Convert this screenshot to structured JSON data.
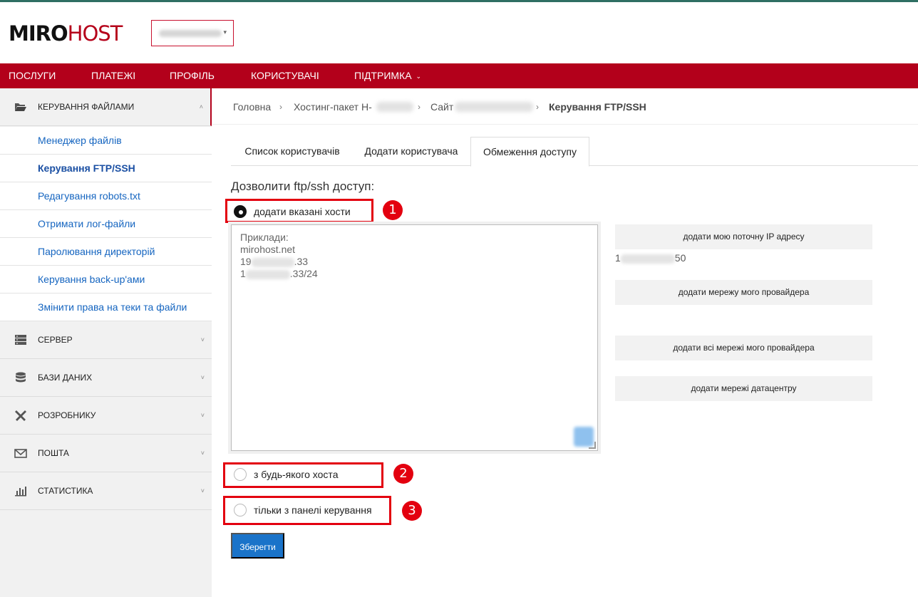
{
  "header": {
    "logo_part1": "MIRO",
    "logo_part2": "HOST",
    "domain_selector": {
      "value": ""
    }
  },
  "nav": [
    {
      "label": "ПОСЛУГИ"
    },
    {
      "label": "ПЛАТЕЖІ"
    },
    {
      "label": "ПРОФІЛЬ"
    },
    {
      "label": "КОРИСТУВАЧІ"
    },
    {
      "label": "ПІДТРИМКА"
    }
  ],
  "sidebar": {
    "file_management": {
      "label": "КЕРУВАННЯ ФАЙЛАМИ",
      "items": [
        {
          "label": "Менеджер файлів"
        },
        {
          "label": "Керування FTP/SSH"
        },
        {
          "label": "Редагування robots.txt"
        },
        {
          "label": "Отримати лог-файли"
        },
        {
          "label": "Паролювання директорій"
        },
        {
          "label": "Керування back-up'ами"
        },
        {
          "label": "Змінити права на теки та файли"
        }
      ]
    },
    "sections": [
      {
        "label": "СЕРВЕР",
        "icon": "server-icon"
      },
      {
        "label": "БАЗИ ДАНИХ",
        "icon": "database-icon"
      },
      {
        "label": "РОЗРОБНИКУ",
        "icon": "tools-icon"
      },
      {
        "label": "ПОШТА",
        "icon": "mail-icon"
      },
      {
        "label": "СТАТИСТИКА",
        "icon": "chart-icon"
      }
    ]
  },
  "breadcrumb": {
    "home": "Головна",
    "hosting": "Хостинг-пакет Н-",
    "site": "Сайт",
    "current": "Керування FTP/SSH"
  },
  "tabs": [
    {
      "label": "Список користувачів"
    },
    {
      "label": "Додати користувача"
    },
    {
      "label": "Обмеження доступу"
    }
  ],
  "access": {
    "title": "Дозволити ftp/ssh доступ:",
    "options": [
      {
        "label": "додати вказані хости",
        "checked": true,
        "badge": "1"
      },
      {
        "label": "з будь-якого хоста",
        "checked": false,
        "badge": "2"
      },
      {
        "label": "тільки з панелі керування",
        "checked": false,
        "badge": "3"
      }
    ],
    "hosts_examples": {
      "line1": "Приклади:",
      "line2": "mirohost.net",
      "line3_prefix": "19",
      "line3_suffix": ".33",
      "line4_prefix": "1",
      "line4_suffix": ".33/24"
    },
    "current_ip": {
      "prefix": "1",
      "suffix": "50"
    },
    "buttons": {
      "add_my_ip": "додати мою поточну IP адресу",
      "add_provider_network": "додати мережу мого провайдера",
      "add_all_provider_networks": "додати всі мережі мого провайдера",
      "add_datacenter_networks": "додати мережі датацентру"
    },
    "save": "Зберегти"
  },
  "colors": {
    "brand_red": "#b3001b",
    "link_blue": "#1565c0",
    "primary_button": "#1a73c9",
    "annotation_red": "#e3000f"
  }
}
